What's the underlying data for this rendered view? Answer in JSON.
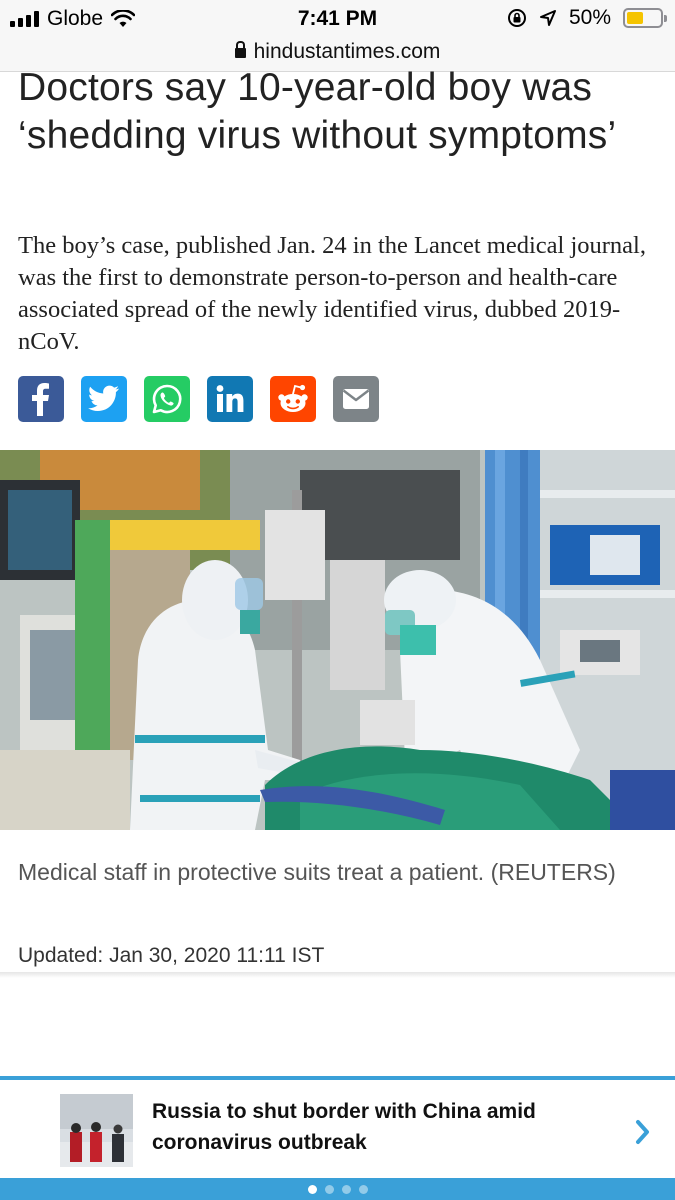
{
  "status_bar": {
    "carrier": "Globe",
    "time": "7:41 PM",
    "battery": "50%",
    "battery_level": 0.5,
    "battery_color": "#f5c400"
  },
  "browser": {
    "url": "hindustantimes.com"
  },
  "article": {
    "headline": "Doctors say 10-year-old boy was ‘shedding virus without symptoms’",
    "summary": "The boy’s case, published Jan. 24 in the Lancet medical journal, was the first to demonstrate person-to-person and health-care associated spread of the newly identified virus, dubbed 2019-nCoV.",
    "caption": "Medical staff in protective suits treat a patient. (REUTERS)",
    "updated": "Updated: Jan 30, 2020 11:11 IST"
  },
  "share": {
    "buttons": [
      {
        "icon": "facebook-icon",
        "color": "#3b5a98"
      },
      {
        "icon": "twitter-icon",
        "color": "#1da1f2"
      },
      {
        "icon": "whatsapp-icon",
        "color": "#25cc64"
      },
      {
        "icon": "linkedin-icon",
        "color": "#1178b3"
      },
      {
        "icon": "reddit-icon",
        "color": "#ff4500"
      },
      {
        "icon": "email-icon",
        "color": "#7d8488"
      }
    ]
  },
  "recommendation": {
    "title": "Russia to shut border with China amid coronavirus outbreak",
    "accent": "#3aa0d8",
    "pages": 4,
    "active_page": 1
  }
}
